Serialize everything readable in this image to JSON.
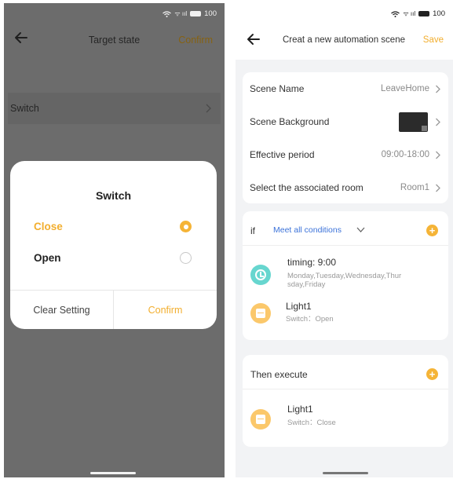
{
  "status_bar": {
    "signal": "ᯤ ııl",
    "battery": "100"
  },
  "left_screen": {
    "header": {
      "title": "Target state",
      "confirm_label": "Confirm"
    },
    "switch_row_label": "Switch",
    "dialog": {
      "title": "Switch",
      "options": [
        {
          "label": "Close",
          "selected": true
        },
        {
          "label": "Open",
          "selected": false
        }
      ],
      "clear_label": "Clear Setting",
      "confirm_label": "Confirm"
    }
  },
  "right_screen": {
    "header": {
      "title": "Creat a new automation scene",
      "save_label": "Save"
    },
    "settings": [
      {
        "label": "Scene Name",
        "value": "LeaveHome"
      },
      {
        "label": "Scene Background",
        "value": ""
      },
      {
        "label": "Effective period",
        "value": "09:00-18:00"
      },
      {
        "label": "Select the associated room",
        "value": "Room1"
      }
    ],
    "if_section": {
      "label": "if",
      "condition_mode": "Meet all conditions",
      "conditions": [
        {
          "icon": "clock-icon",
          "title": "timing: 9:00",
          "sub_line1": "Monday,Tuesday,Wednesday,Thur",
          "sub_line2": "sday,Friday"
        },
        {
          "icon": "light-icon",
          "title": "Light1",
          "sub": "Switch：Open"
        }
      ]
    },
    "then_section": {
      "label": "Then execute",
      "actions": [
        {
          "icon": "light-icon",
          "title": "Light1",
          "sub": "Switch：Close"
        }
      ]
    }
  },
  "colors": {
    "accent": "#f5b437",
    "link_blue": "#3b72d9",
    "teal_icon": "#67d6cf"
  }
}
